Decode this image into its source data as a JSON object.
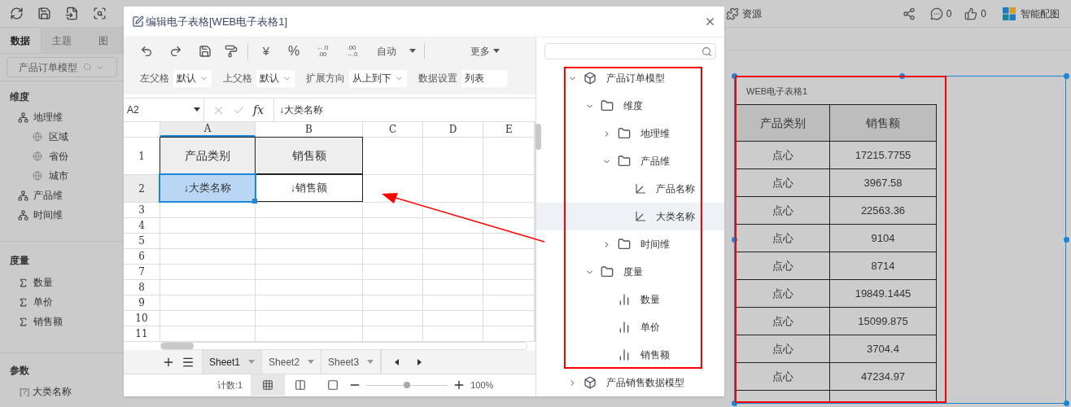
{
  "top_bar": {
    "resource_label": "资源",
    "comment_count": "0",
    "like_count": "0",
    "smart_chart_label": "智能配图"
  },
  "left_panel": {
    "tabs": [
      {
        "label": "数据",
        "selected": true
      },
      {
        "label": "主题",
        "selected": false
      },
      {
        "label": "图",
        "selected": false
      }
    ],
    "model_select": "产品订单模型",
    "dimensions": {
      "title": "维度",
      "items": [
        {
          "label": "地理维",
          "children": [
            {
              "label": "区域"
            },
            {
              "label": "省份"
            },
            {
              "label": "城市"
            }
          ]
        },
        {
          "label": "产品维"
        },
        {
          "label": "时间维"
        }
      ]
    },
    "measures": {
      "title": "度量",
      "items": [
        "数量",
        "单价",
        "销售额"
      ]
    },
    "parameters": {
      "title": "参数",
      "items": [
        {
          "marker": "[?]",
          "label": "大类名称"
        }
      ]
    }
  },
  "dialog": {
    "title": "编辑电子表格[WEB电子表格1]",
    "toolbar": {
      "currency": "¥",
      "percent": "%",
      "decimals": [
        {
          "top": "←.0",
          "bottom": ".00"
        },
        {
          "top": ".00",
          "bottom": "→.0"
        }
      ],
      "format_select": "自动",
      "more": "更多"
    },
    "properties": [
      {
        "label": "左父格",
        "value": "默认",
        "dropdown": true
      },
      {
        "label": "上父格",
        "value": "默认",
        "dropdown": true
      },
      {
        "label": "扩展方向",
        "value": "从上到下",
        "dropdown": true
      },
      {
        "label": "数据设置",
        "value": "列表",
        "dropdown": false
      }
    ],
    "formula_bar": {
      "cell_ref": "A2",
      "fx": "fx",
      "value": "↓大类名称"
    },
    "grid": {
      "columns": [
        {
          "label": "A",
          "selected": true
        },
        {
          "label": "B",
          "selected": false
        },
        {
          "label": "C",
          "selected": false
        },
        {
          "label": "D",
          "selected": false
        },
        {
          "label": "E",
          "selected": false
        }
      ],
      "rows": [
        {
          "label": "1",
          "selected": false,
          "cells": [
            {
              "text": "产品类别",
              "kind": "header",
              "selected": false
            },
            {
              "text": "销售额",
              "kind": "header",
              "selected": false
            }
          ]
        },
        {
          "label": "2",
          "selected": true,
          "cells": [
            {
              "text": "↓大类名称",
              "kind": "field",
              "selected": true
            },
            {
              "text": "↓销售额",
              "kind": "field",
              "selected": false
            }
          ]
        },
        {
          "label": "3",
          "selected": false,
          "cells": []
        },
        {
          "label": "4",
          "selected": false,
          "cells": []
        },
        {
          "label": "5",
          "selected": false,
          "cells": []
        },
        {
          "label": "6",
          "selected": false,
          "cells": []
        },
        {
          "label": "7",
          "selected": false,
          "cells": []
        },
        {
          "label": "8",
          "selected": false,
          "cells": []
        },
        {
          "label": "9",
          "selected": false,
          "cells": []
        },
        {
          "label": "10",
          "selected": false,
          "cells": []
        },
        {
          "label": "11",
          "selected": false,
          "cells": []
        }
      ]
    },
    "sheets": [
      {
        "label": "Sheet1",
        "selected": true
      },
      {
        "label": "Sheet2",
        "selected": false
      },
      {
        "label": "Sheet3",
        "selected": false
      }
    ],
    "status_bar": {
      "count": "计数:1",
      "zoom": "100%",
      "zoom_level": {
        "level": 0.5
      }
    },
    "tree": {
      "nodes": [
        {
          "label": "产品订单模型",
          "kind": "model",
          "expanded": true,
          "selected": false,
          "children": [
            {
              "label": "维度",
              "kind": "folder",
              "expanded": true,
              "selected": false,
              "children": [
                {
                  "label": "地理维",
                  "kind": "folder",
                  "expanded": false,
                  "selected": false
                },
                {
                  "label": "产品维",
                  "kind": "folder",
                  "expanded": true,
                  "selected": false,
                  "children": [
                    {
                      "label": "产品名称",
                      "kind": "field",
                      "selected": false
                    },
                    {
                      "label": "大类名称",
                      "kind": "field",
                      "selected": true
                    }
                  ]
                },
                {
                  "label": "时间维",
                  "kind": "folder",
                  "expanded": false,
                  "selected": false
                }
              ]
            },
            {
              "label": "度量",
              "kind": "folder",
              "expanded": true,
              "selected": false,
              "children": [
                {
                  "label": "数量",
                  "kind": "measure",
                  "selected": false
                },
                {
                  "label": "单价",
                  "kind": "measure",
                  "selected": false
                },
                {
                  "label": "销售额",
                  "kind": "measure",
                  "selected": false
                }
              ]
            }
          ]
        },
        {
          "label": "产品销售数据模型",
          "kind": "model",
          "expanded": false,
          "selected": false
        }
      ]
    }
  },
  "canvas": {
    "widget": {
      "title": "WEB电子表格1",
      "columns": [
        "产品类别",
        "销售额"
      ],
      "rows": [
        [
          "点心",
          "17215.7755"
        ],
        [
          "点心",
          "3967.58"
        ],
        [
          "点心",
          "22563.36"
        ],
        [
          "点心",
          "9104"
        ],
        [
          "点心",
          "8714"
        ],
        [
          "点心",
          "19849.1445"
        ],
        [
          "点心",
          "15099.875"
        ],
        [
          "点心",
          "3704.4"
        ],
        [
          "点心",
          "47234.97"
        ]
      ]
    }
  }
}
